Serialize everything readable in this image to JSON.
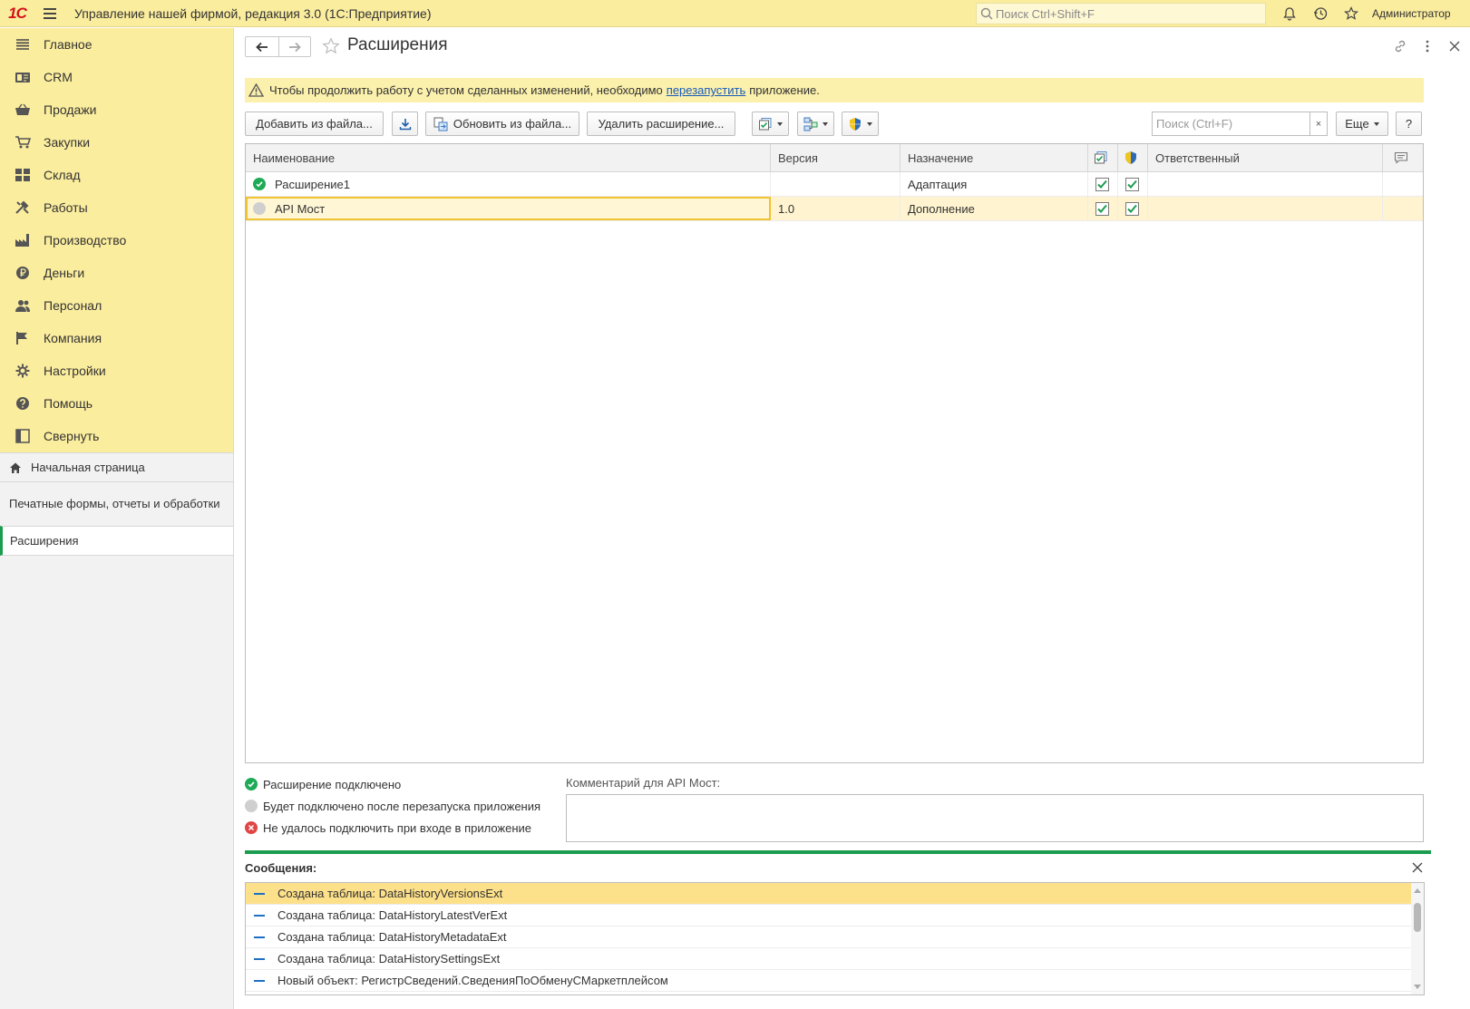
{
  "topbar": {
    "logo_text": "1С",
    "app_title": "Управление нашей фирмой, редакция 3.0  (1С:Предприятие)",
    "search_placeholder": "Поиск Ctrl+Shift+F",
    "user": "Администратор"
  },
  "sidebar": {
    "nav": [
      {
        "label": "Главное",
        "icon": "menu-lines-icon"
      },
      {
        "label": "CRM",
        "icon": "crm-icon"
      },
      {
        "label": "Продажи",
        "icon": "basket-icon"
      },
      {
        "label": "Закупки",
        "icon": "cart-icon"
      },
      {
        "label": "Склад",
        "icon": "warehouse-icon"
      },
      {
        "label": "Работы",
        "icon": "tools-icon"
      },
      {
        "label": "Производство",
        "icon": "factory-icon"
      },
      {
        "label": "Деньги",
        "icon": "ruble-icon"
      },
      {
        "label": "Персонал",
        "icon": "people-icon"
      },
      {
        "label": "Компания",
        "icon": "flag-icon"
      },
      {
        "label": "Настройки",
        "icon": "gear-icon"
      },
      {
        "label": "Помощь",
        "icon": "help-icon"
      },
      {
        "label": "Свернуть",
        "icon": "collapse-icon"
      }
    ],
    "open": {
      "home": "Начальная страница",
      "reports": "Печатные формы, отчеты и обработки",
      "active": "Расширения"
    }
  },
  "main": {
    "title": "Расширения",
    "warning": {
      "before": "Чтобы продолжить работу с учетом сделанных изменений, необходимо",
      "link": "перезапустить",
      "after": "приложение."
    },
    "toolbar": {
      "add": "Добавить из файла...",
      "update": "Обновить из файла...",
      "delete": "Удалить расширение...",
      "search_placeholder": "Поиск (Ctrl+F)",
      "clear": "×",
      "more": "Еще",
      "help": "?"
    },
    "grid": {
      "headers": {
        "name": "Наименование",
        "version": "Версия",
        "purpose": "Назначение",
        "responsible": "Ответственный"
      },
      "rows": [
        {
          "name": "Расширение1",
          "version": "",
          "purpose": "Адаптация",
          "status": "connected",
          "active": true,
          "safe": true
        },
        {
          "name": "API Мост",
          "version": "1.0",
          "purpose": "Дополнение",
          "status": "pending",
          "active": true,
          "safe": true
        }
      ]
    },
    "legend": {
      "connected": "Расширение подключено",
      "pending": "Будет подключено после перезапуска приложения",
      "failed": "Не удалось подключить при входе в приложение"
    },
    "comment_label": "Комментарий для API Мост:"
  },
  "messages": {
    "title": "Сообщения:",
    "items": [
      "Создана таблица: DataHistoryVersionsExt",
      "Создана таблица: DataHistoryLatestVerExt",
      "Создана таблица: DataHistoryMetadataExt",
      "Создана таблица: DataHistorySettingsExt",
      "Новый объект: РегистрСведений.СведенияПоОбменуСМаркетплейсом"
    ]
  },
  "colors": {
    "accent": "#fbed9e",
    "green": "#1b9c4f",
    "warning_bg": "#fbf0ac",
    "selected_row": "#fff4cf"
  }
}
